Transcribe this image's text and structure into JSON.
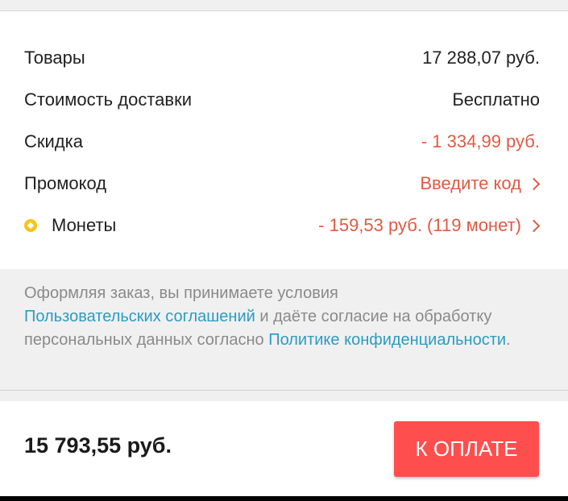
{
  "summary": {
    "items": {
      "label": "Товары",
      "value": "17 288,07 руб."
    },
    "delivery": {
      "label": "Стоимость доставки",
      "value": "Бесплатно"
    },
    "discount": {
      "label": "Скидка",
      "value": "- 1 334,99 руб."
    },
    "promo": {
      "label": "Промокод",
      "value": "Введите код"
    },
    "coins": {
      "label": "Монеты",
      "value": "- 159,53 руб. (119 монет)"
    }
  },
  "terms": {
    "text_1": "Оформляя заказ, вы принимаете условия",
    "link_1": "Пользовательских соглашений",
    "text_2": " и даёте согласие на обработку персональных данных согласно ",
    "link_2": "Политике конфиденциальности",
    "text_3": "."
  },
  "checkout": {
    "total": "15 793,55 руб.",
    "pay_label": "К ОПЛАТЕ"
  },
  "icons": {
    "coin": "coin-icon",
    "chevron": "chevron-right-icon"
  },
  "colors": {
    "accent_red": "#e05a44",
    "button_red": "#ff4e4e",
    "link_blue": "#2a9cc4",
    "coin_yellow": "#f5c518"
  }
}
